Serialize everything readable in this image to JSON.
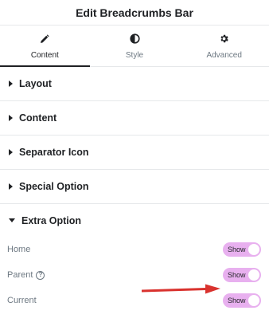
{
  "header": {
    "title": "Edit Breadcrumbs Bar"
  },
  "tabs": [
    {
      "label": "Content",
      "icon": "pencil-icon",
      "active": true
    },
    {
      "label": "Style",
      "icon": "half-circle-icon",
      "active": false
    },
    {
      "label": "Advanced",
      "icon": "gear-icon",
      "active": false
    }
  ],
  "sections": [
    {
      "title": "Layout",
      "expanded": false
    },
    {
      "title": "Content",
      "expanded": false
    },
    {
      "title": "Separator Icon",
      "expanded": false
    },
    {
      "title": "Special Option",
      "expanded": false
    },
    {
      "title": "Extra Option",
      "expanded": true
    }
  ],
  "extra_option": {
    "controls": [
      {
        "label": "Home",
        "toggle_label": "Show",
        "on": true
      },
      {
        "label": "Parent",
        "toggle_label": "Show",
        "on": true,
        "help": "?"
      },
      {
        "label": "Current",
        "toggle_label": "Show",
        "on": true
      }
    ]
  },
  "colors": {
    "toggle_on": "#e8b0ef",
    "annotation_arrow": "#d9322e",
    "text_primary": "#1f2124",
    "text_secondary": "#6d7882"
  }
}
